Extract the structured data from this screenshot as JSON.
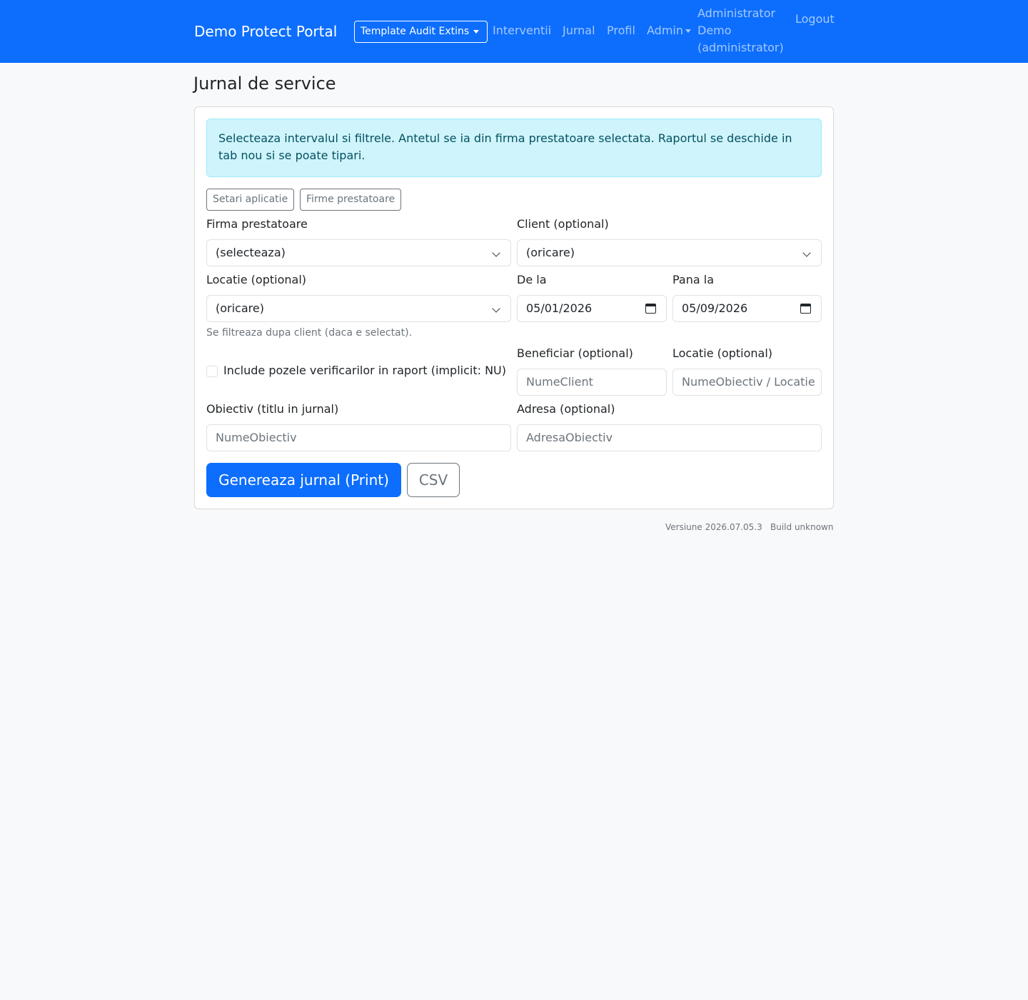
{
  "navbar": {
    "brand": "Demo Protect Portal",
    "template_dropdown": "Template Audit Extins",
    "links": [
      "Interventii",
      "Jurnal",
      "Profil"
    ],
    "admin": "Admin",
    "user_line1": "Administrator",
    "user_line2": "Demo",
    "user_line3": "(administrator)",
    "logout": "Logout"
  },
  "page": {
    "title": "Jurnal de service"
  },
  "form": {
    "alert": "Selecteaza intervalul si filtrele. Antetul se ia din firma prestatoare selectata. Raportul se deschide in tab nou si se poate tipari.",
    "settings_button": "Setari aplicatie",
    "firms_button": "Firme prestatoare",
    "firm_label": "Firma prestatoare",
    "firm_value": "(selecteaza)",
    "client_label": "Client (optional)",
    "client_value": "(oricare)",
    "location_label": "Locatie (optional)",
    "location_value": "(oricare)",
    "location_help": "Se filtreaza dupa client (daca e selectat).",
    "from_label": "De la",
    "from_value": "05/01/2026",
    "to_label": "Pana la",
    "to_value": "05/09/2026",
    "photos_checked": false,
    "photos_label": "Include pozele verificarilor in raport (implicit: NU)",
    "beneficiary_label": "Beneficiar (optional)",
    "beneficiary_placeholder": "NumeClient",
    "location2_label": "Locatie (optional)",
    "location2_placeholder": "NumeObiectiv / Locatie",
    "objective_label": "Obiectiv (titlu in jurnal)",
    "objective_placeholder": "NumeObiectiv",
    "address_label": "Adresa (optional)",
    "address_placeholder": "AdresaObiectiv",
    "generate_button": "Genereaza jurnal (Print)",
    "csv_button": "CSV"
  },
  "footer": {
    "version": "Versiune 2026.07.05.3",
    "build": "Build unknown"
  }
}
